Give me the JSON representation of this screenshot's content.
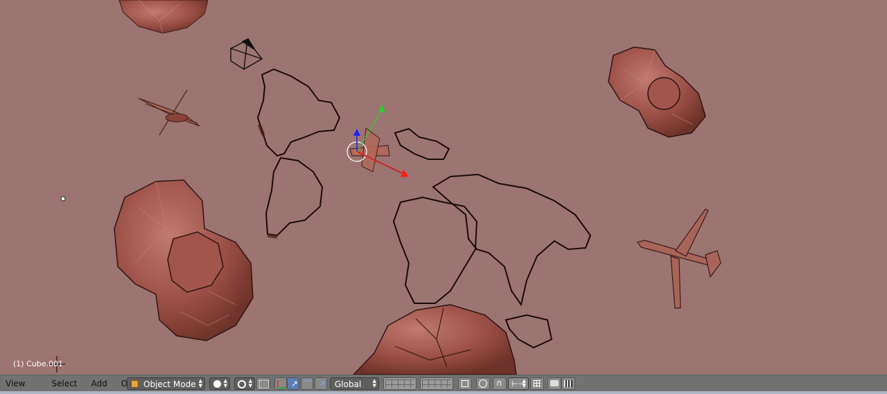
{
  "viewport": {
    "object_label": "(1) Cube.001"
  },
  "header": {
    "menus": [
      {
        "label": "View"
      },
      {
        "label": "Select"
      },
      {
        "label": "Add"
      },
      {
        "label": "Object"
      }
    ],
    "mode_dropdown": {
      "label": "Object Mode",
      "icon": "cube-icon"
    },
    "orientation_dropdown": {
      "label": "Global"
    },
    "colors": {
      "header_bg": "#727272",
      "viewport_bg": "#9c7472",
      "active_button": "#5a7fb5"
    }
  }
}
